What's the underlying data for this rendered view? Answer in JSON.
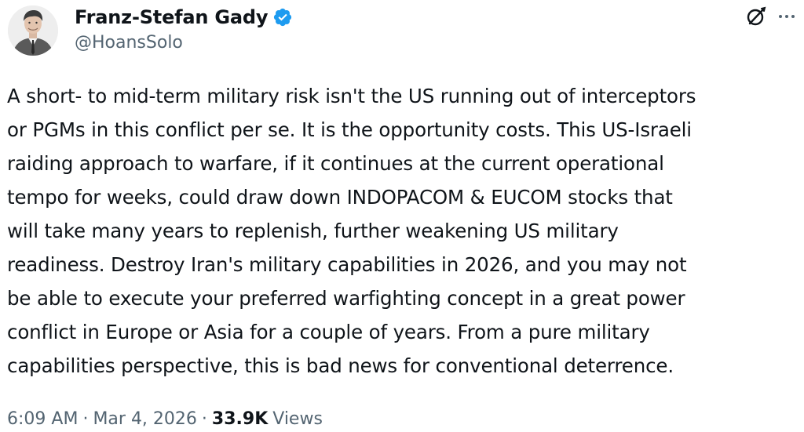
{
  "author": {
    "name": "Franz-Stefan Gady",
    "handle": "@HoansSolo",
    "verified": true,
    "verified_color": "#1d9bf0"
  },
  "actions": {
    "grok_icon": "grok-icon",
    "more_icon": "more-dots-icon"
  },
  "tweet": {
    "text_lines": [
      "A short- to mid-term military risk isn't the US running out of interceptors",
      "or PGMs in this conflict per se. It is the opportunity costs. This US-Israeli",
      "raiding approach to warfare, if it continues at the current operational",
      "tempo for weeks, could draw down INDOPACOM & EUCOM stocks that",
      "will take many years to replenish, further weakening US military",
      "readiness. Destroy Iran's military capabilities in 2026, and you may not",
      "be able to execute your preferred warfighting concept in a great power",
      "conflict in Europe or Asia for a couple of years. From a pure military",
      "capabilities perspective, this is bad news for conventional deterrence."
    ]
  },
  "meta": {
    "time": "6:09 AM",
    "separator": "·",
    "date": "Mar 4, 2026",
    "views_count": "33.9K",
    "views_label": "Views"
  },
  "colors": {
    "text": "#0f1419",
    "secondary": "#536471",
    "background": "#ffffff"
  }
}
